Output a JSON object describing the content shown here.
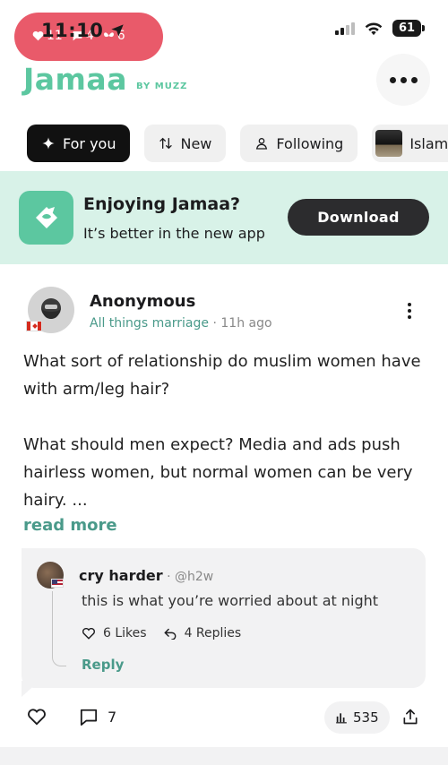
{
  "status_bar": {
    "time": "11:10",
    "notif_likes": "11",
    "notif_comments": "4",
    "notif_other": "6",
    "battery": "61"
  },
  "header": {
    "brand": "Jamaa",
    "brand_sub": "BY MUZZ"
  },
  "tabs": [
    {
      "label": "For you",
      "icon": "sparkle-icon",
      "active": true
    },
    {
      "label": "New",
      "icon": "sort-icon"
    },
    {
      "label": "Following",
      "icon": "person-icon"
    },
    {
      "label": "Islam",
      "icon": "kaaba-thumbnail"
    }
  ],
  "banner": {
    "title": "Enjoying Jamaa?",
    "subtitle": "It’s better in the new app",
    "button": "Download"
  },
  "post": {
    "author": "Anonymous",
    "category": "All things marriage",
    "time": "11h ago",
    "body_1": "What sort of relationship do muslim women have with arm/leg hair?",
    "body_2": "What should men expect? Media and ads push hairless women, but normal women can be very hairy. ...",
    "read_more": "read more",
    "comments": "7",
    "views": "535"
  },
  "reply": {
    "name": "cry harder",
    "handle": "@h2w",
    "text": "this is what you’re worried about at night",
    "likes": "6 Likes",
    "replies": "4 Replies",
    "reply_label": "Reply"
  },
  "colors": {
    "brand": "#5cc7a0",
    "accent_text": "#4a9a8a",
    "banner_bg": "#d8f2e8",
    "pill": "#e95a6a"
  }
}
